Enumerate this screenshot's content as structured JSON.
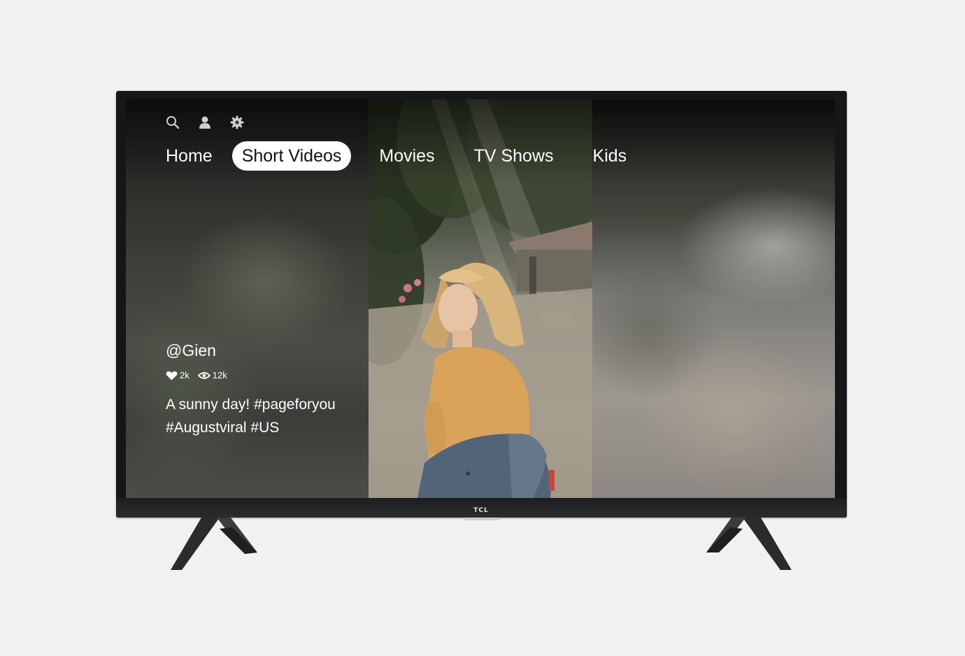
{
  "device": {
    "brand": "TCL"
  },
  "toolbar": {
    "icons": [
      "search-icon",
      "profile-icon",
      "settings-icon"
    ]
  },
  "nav": {
    "tabs": [
      {
        "label": "Home",
        "active": false
      },
      {
        "label": "Short Videos",
        "active": true
      },
      {
        "label": "Movies",
        "active": false
      },
      {
        "label": "TV Shows",
        "active": false
      },
      {
        "label": "Kids",
        "active": false
      }
    ]
  },
  "video": {
    "username": "@Gien",
    "likes": "2k",
    "views": "12k",
    "caption_line1": "A sunny day! #pageforyou",
    "caption_line2": "#Augustviral #US"
  },
  "colors": {
    "active_tab_bg": "#ffffff",
    "text": "#ffffff",
    "bezel": "#151617",
    "background": "#f1f1f1"
  }
}
